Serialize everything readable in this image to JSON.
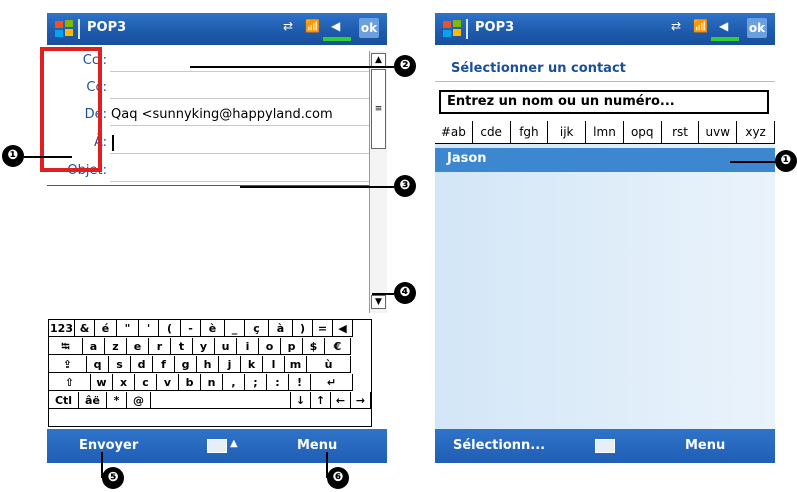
{
  "left": {
    "title": "POP3",
    "ok": "ok",
    "fields": {
      "bcc": "Cci:",
      "cc": "Cc:",
      "from": "De:",
      "from_value": "Qaq <sunnyking@happyland.com",
      "to": "À:",
      "subject": "Objet:"
    },
    "keyboard": {
      "row1": [
        "123",
        "&",
        "é",
        "\"",
        "'",
        "(",
        "-",
        "è",
        "_",
        "ç",
        "à",
        ")",
        "=",
        "◀"
      ],
      "row2": [
        "⭾",
        "a",
        "z",
        "e",
        "r",
        "t",
        "y",
        "u",
        "i",
        "o",
        "p",
        "$",
        "€"
      ],
      "row3": [
        "⇪",
        "q",
        "s",
        "d",
        "f",
        "g",
        "h",
        "j",
        "k",
        "l",
        "m",
        "ù"
      ],
      "row4": [
        "⇧",
        "w",
        "x",
        "c",
        "v",
        "b",
        "n",
        ",",
        ";",
        ":",
        "!",
        "↵"
      ],
      "row5": [
        "Ctl",
        "âë",
        "*",
        "@",
        "",
        "↓",
        "↑",
        "←",
        "→"
      ]
    },
    "softkeys": {
      "left": "Envoyer",
      "right": "Menu"
    }
  },
  "right": {
    "title": "POP3",
    "ok": "ok",
    "heading": "Sélectionner un contact",
    "search_placeholder": "Entrez un nom ou un numéro...",
    "letter_tabs": [
      "#ab",
      "cde",
      "fgh",
      "ijk",
      "lmn",
      "opq",
      "rst",
      "uvw",
      "xyz"
    ],
    "contact_selected": "Jason",
    "softkeys": {
      "left": "Sélectionn...",
      "right": "Menu"
    }
  },
  "callouts": [
    "❶",
    "❷",
    "❸",
    "❹",
    "❺",
    "❻",
    "❶"
  ],
  "colors": {
    "title_bar": "#1d5aac",
    "accent_red": "#e02020",
    "selected": "#3d86d0",
    "text_blue": "#1a4f9c"
  }
}
